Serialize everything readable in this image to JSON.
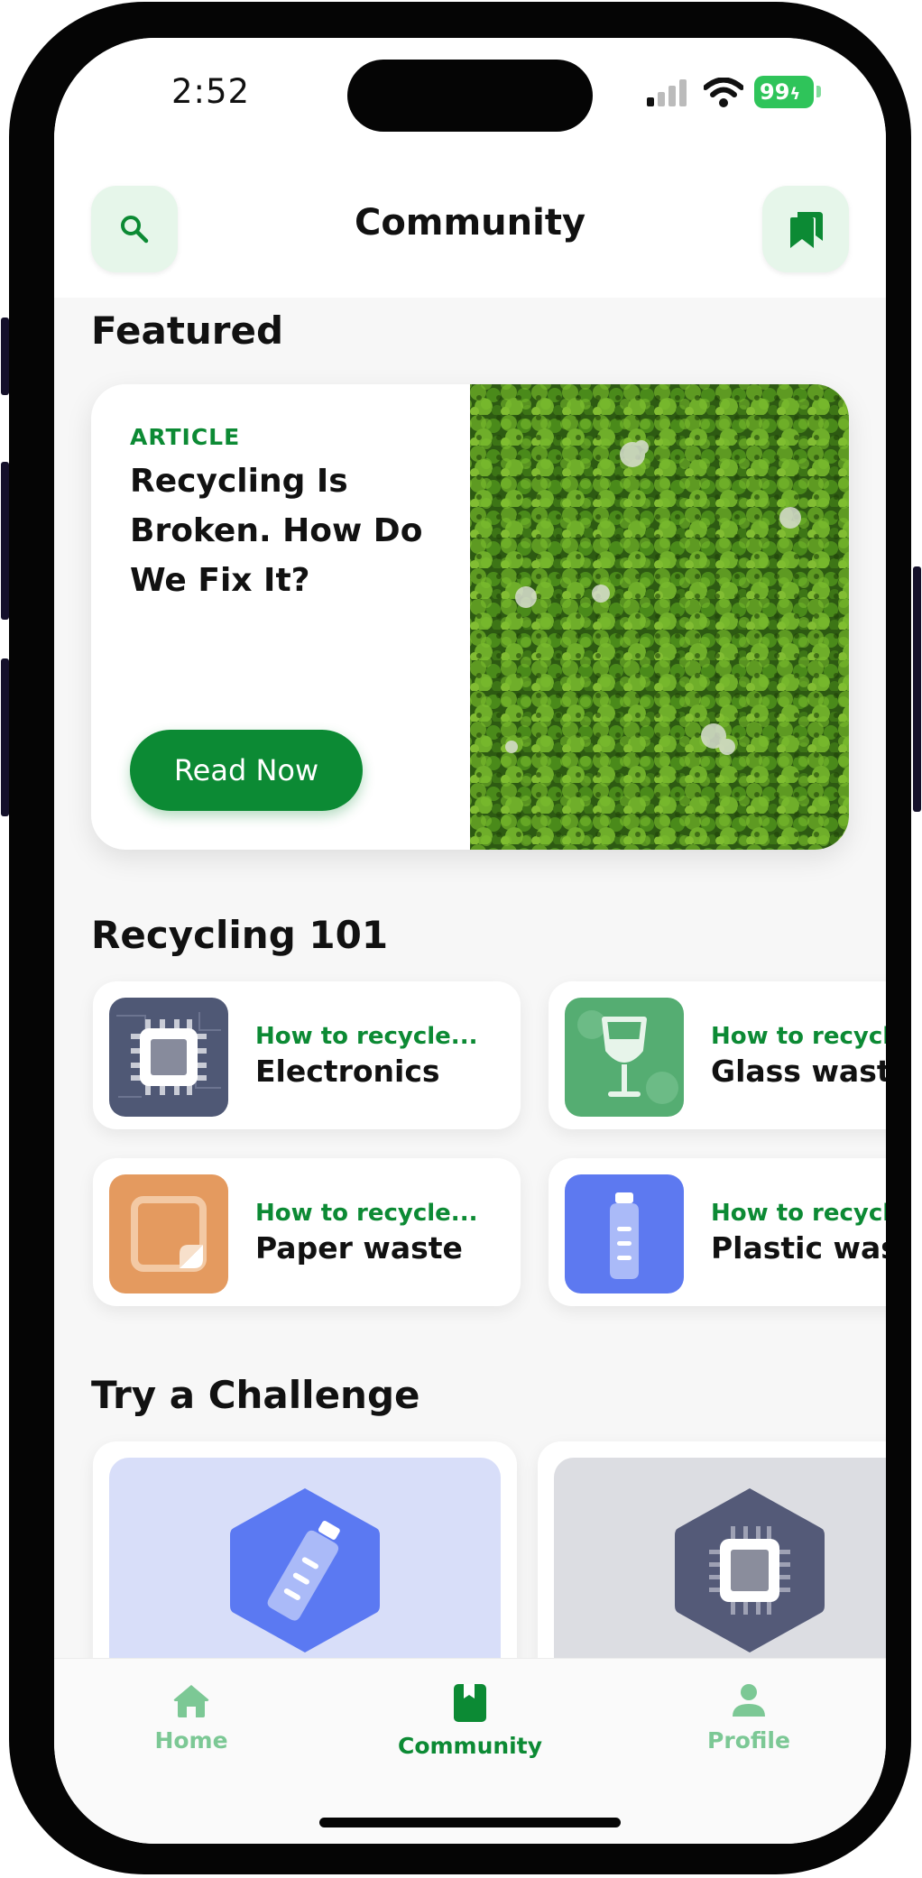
{
  "status": {
    "time": "2:52",
    "battery": "99"
  },
  "header": {
    "title": "Community",
    "search_icon": "search-icon",
    "bookmark_icon": "bookmark-icon"
  },
  "featured": {
    "section_title": "Featured",
    "tag": "ARTICLE",
    "title": "Recycling Is Broken. How Do We Fix It?",
    "button": "Read Now",
    "image": "aerial-forest-image"
  },
  "recycling101": {
    "section_title": "Recycling 101",
    "items": [
      {
        "prefix": "How to recycle...",
        "name": "Electronics",
        "icon": "chip-icon",
        "color": "#4f5875"
      },
      {
        "prefix": "How to recycle...",
        "name": "Glass waste",
        "icon": "wine-glass-icon",
        "color": "#55ad72"
      },
      {
        "prefix": "How to recycle...",
        "name": "Paper waste",
        "icon": "paper-icon",
        "color": "#e49a5f"
      },
      {
        "prefix": "How to recycle...",
        "name": "Plastic waste",
        "icon": "bottle-icon",
        "color": "#5d79f0"
      }
    ]
  },
  "challenges": {
    "section_title": "Try a Challenge",
    "items": [
      {
        "icon": "bottle-icon",
        "bg": "#d8def9",
        "badge": "#5b79f2"
      },
      {
        "icon": "chip-icon",
        "bg": "#dcdde2",
        "badge": "#545a78"
      }
    ]
  },
  "tabs": [
    {
      "label": "Home",
      "icon": "home-icon",
      "active": false
    },
    {
      "label": "Community",
      "icon": "book-icon",
      "active": true
    },
    {
      "label": "Profile",
      "icon": "person-icon",
      "active": false
    }
  ],
  "colors": {
    "accent": "#0c8a34",
    "accent_light": "#e6f6ea",
    "inactive_tab": "#7cc895"
  }
}
